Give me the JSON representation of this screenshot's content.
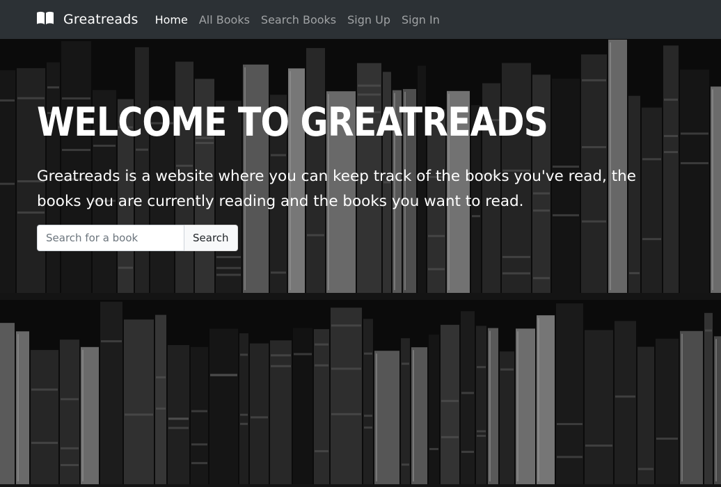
{
  "nav": {
    "brand": "Greatreads",
    "links": [
      {
        "label": "Home",
        "active": true
      },
      {
        "label": "All Books",
        "active": false
      },
      {
        "label": "Search Books",
        "active": false
      },
      {
        "label": "Sign Up",
        "active": false
      },
      {
        "label": "Sign In",
        "active": false
      }
    ]
  },
  "hero": {
    "title": "WELCOME TO GREATREADS",
    "description": "Greatreads is a website where you can keep track of the books you've read, the books you are currently reading and the books you want to read.",
    "search": {
      "placeholder": "Search for a book",
      "value": "",
      "button_label": "Search"
    }
  },
  "icons": {
    "brand": "book-open-icon"
  },
  "colors": {
    "navbar_bg": "#2c3135",
    "nav_active": "#ffffff",
    "nav_inactive": "rgba(255,255,255,0.55)",
    "hero_bg": "#0b0b0b"
  }
}
